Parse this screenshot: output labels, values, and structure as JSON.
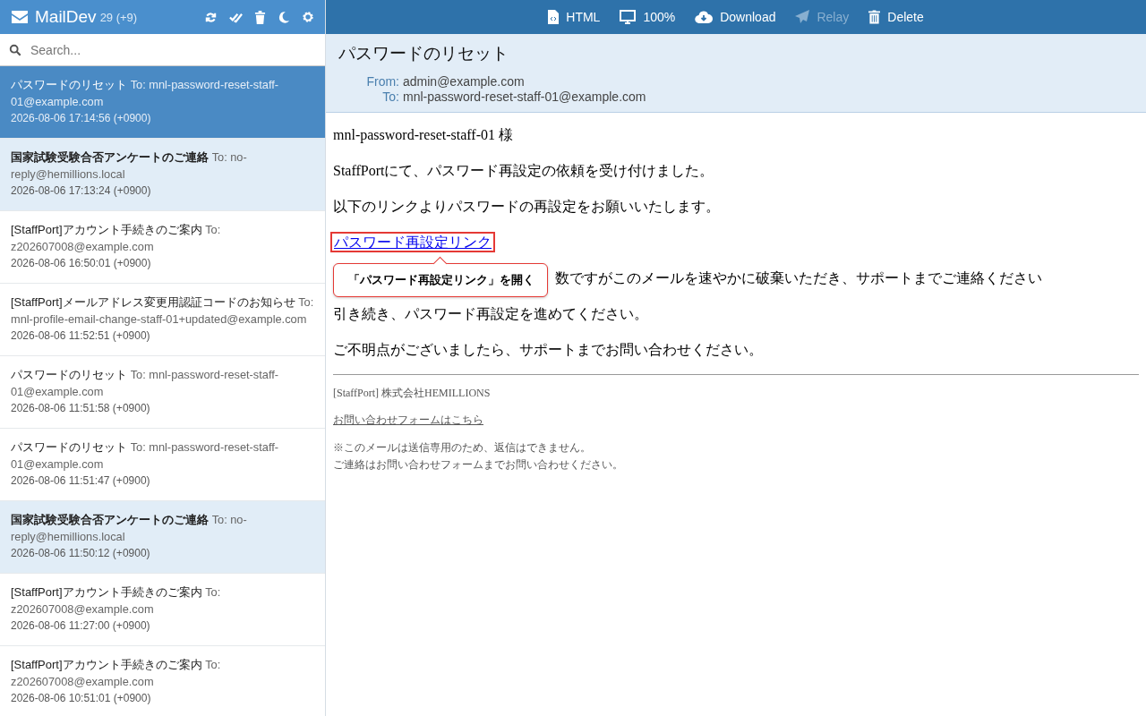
{
  "app": {
    "name": "MailDev",
    "count": "29",
    "new_count": "(+9)"
  },
  "search": {
    "placeholder": "Search..."
  },
  "toolbar": [
    {
      "label": "HTML",
      "kind": "html",
      "disabled": false
    },
    {
      "label": "100%",
      "kind": "screen",
      "disabled": false
    },
    {
      "label": "Download",
      "kind": "download",
      "disabled": false
    },
    {
      "label": "Relay",
      "kind": "relay",
      "disabled": true
    },
    {
      "label": "Delete",
      "kind": "delete",
      "disabled": false
    }
  ],
  "emails": [
    {
      "subject": "パスワードのリセット",
      "to": "To: mnl-password-reset-staff-01@example.com",
      "date": "2026-08-06 17:14:56 (+0900)",
      "selected": true,
      "unread": false
    },
    {
      "subject": "国家試験受験合否アンケートのご連絡",
      "to": "To: no-reply@hemillions.local",
      "date": "2026-08-06 17:13:24 (+0900)",
      "selected": false,
      "unread": true
    },
    {
      "subject": "[StaffPort]アカウント手続きのご案内",
      "to": "To: z202607008@example.com",
      "date": "2026-08-06 16:50:01 (+0900)",
      "selected": false,
      "unread": false
    },
    {
      "subject": "[StaffPort]メールアドレス変更用認証コードのお知らせ",
      "to": "To: mnl-profile-email-change-staff-01+updated@example.com",
      "date": "2026-08-06 11:52:51 (+0900)",
      "selected": false,
      "unread": false
    },
    {
      "subject": "パスワードのリセット",
      "to": "To: mnl-password-reset-staff-01@example.com",
      "date": "2026-08-06 11:51:58 (+0900)",
      "selected": false,
      "unread": false
    },
    {
      "subject": "パスワードのリセット",
      "to": "To: mnl-password-reset-staff-01@example.com",
      "date": "2026-08-06 11:51:47 (+0900)",
      "selected": false,
      "unread": false
    },
    {
      "subject": "国家試験受験合否アンケートのご連絡",
      "to": "To: no-reply@hemillions.local",
      "date": "2026-08-06 11:50:12 (+0900)",
      "selected": false,
      "unread": true
    },
    {
      "subject": "[StaffPort]アカウント手続きのご案内",
      "to": "To: z202607008@example.com",
      "date": "2026-08-06 11:27:00 (+0900)",
      "selected": false,
      "unread": false
    },
    {
      "subject": "[StaffPort]アカウント手続きのご案内",
      "to": "To: z202607008@example.com",
      "date": "2026-08-06 10:51:01 (+0900)",
      "selected": false,
      "unread": false
    }
  ],
  "message": {
    "subject": "パスワードのリセット",
    "from_label": "From:",
    "from": "admin@example.com",
    "to_label": "To:",
    "to": "mnl-password-reset-staff-01@example.com",
    "body": [
      {
        "kind": "text",
        "text": "mnl-password-reset-staff-01 様"
      },
      {
        "kind": "text",
        "text": "StaffPortにて、パスワード再設定の依頼を受け付けました。"
      },
      {
        "kind": "text",
        "text": "以下のリンクよりパスワードの再設定をお願いいたします。"
      },
      {
        "kind": "link",
        "text": "パスワード再設定リンク"
      },
      {
        "kind": "partial",
        "text": "数ですがこのメールを速やかに破棄いただき、サポートまでご連絡ください"
      },
      {
        "kind": "text",
        "text": "引き続き、パスワード再設定を進めてください。"
      },
      {
        "kind": "text",
        "text": "ご不明点がございましたら、サポートまでお問い合わせください。"
      }
    ],
    "footer": {
      "company": "[StaffPort] 株式会社HEMILLIONS",
      "link": "お問い合わせフォームはこちら",
      "notes": [
        "※このメールは送信専用のため、返信はできません。",
        "ご連絡はお問い合わせフォームまでお問い合わせください。"
      ]
    },
    "tooltip": "「パスワード再設定リンク」を開く"
  }
}
